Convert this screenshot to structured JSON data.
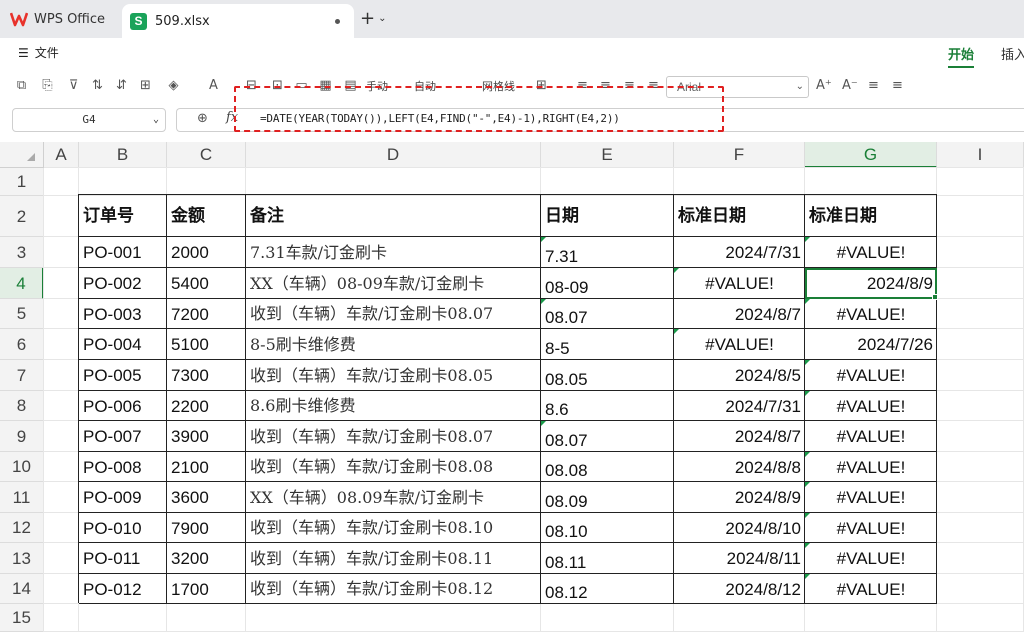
{
  "app": {
    "name": "WPS Office",
    "doc_tab": "509.xlsx",
    "doc_badge": "S"
  },
  "menu": {
    "file": "文件",
    "start": "开始",
    "insert": "插入"
  },
  "toolbar": {
    "manual": "手动",
    "auto": "自动",
    "gridlines": "网格线",
    "font": "Arial"
  },
  "formula_bar": {
    "name_box": "G4",
    "formula": "=DATE(YEAR(TODAY()),LEFT(E4,FIND(\"-\",E4)-1),RIGHT(E4,2))"
  },
  "columns": [
    "A",
    "B",
    "C",
    "D",
    "E",
    "F",
    "G",
    "I"
  ],
  "rows": [
    "1",
    "2",
    "3",
    "4",
    "5",
    "6",
    "7",
    "8",
    "9",
    "10",
    "11",
    "12",
    "13",
    "14",
    "15"
  ],
  "table": {
    "headers": [
      "订单号",
      "金额",
      "备注",
      "日期",
      "标准日期",
      "标准日期"
    ],
    "rows": [
      [
        "PO-001",
        "2000",
        "7.31车款/订金刷卡",
        "7.31",
        "2024/7/31",
        "#VALUE!"
      ],
      [
        "PO-002",
        "5400",
        "XX（车辆）08-09车款/订金刷卡",
        "08-09",
        "#VALUE!",
        "2024/8/9"
      ],
      [
        "PO-003",
        "7200",
        "收到（车辆）车款/订金刷卡08.07",
        "08.07",
        "2024/8/7",
        "#VALUE!"
      ],
      [
        "PO-004",
        "5100",
        "8-5刷卡维修费",
        "8-5",
        "#VALUE!",
        "2024/7/26"
      ],
      [
        "PO-005",
        "7300",
        "收到（车辆）车款/订金刷卡08.05",
        "08.05",
        "2024/8/5",
        "#VALUE!"
      ],
      [
        "PO-006",
        "2200",
        "8.6刷卡维修费",
        "8.6",
        "2024/7/31",
        "#VALUE!"
      ],
      [
        "PO-007",
        "3900",
        "收到（车辆）车款/订金刷卡08.07",
        "08.07",
        "2024/8/7",
        "#VALUE!"
      ],
      [
        "PO-008",
        "2100",
        "收到（车辆）车款/订金刷卡08.08",
        "08.08",
        "2024/8/8",
        "#VALUE!"
      ],
      [
        "PO-009",
        "3600",
        "XX（车辆）08.09车款/订金刷卡",
        "08.09",
        "2024/8/9",
        "#VALUE!"
      ],
      [
        "PO-010",
        "7900",
        "收到（车辆）车款/订金刷卡08.10",
        "08.10",
        "2024/8/10",
        "#VALUE!"
      ],
      [
        "PO-011",
        "3200",
        "收到（车辆）车款/订金刷卡08.11",
        "08.11",
        "2024/8/11",
        "#VALUE!"
      ],
      [
        "PO-012",
        "1700",
        "收到（车辆）车款/订金刷卡08.12",
        "08.12",
        "2024/8/12",
        "#VALUE!"
      ]
    ]
  },
  "colors": {
    "accent": "#1a7f37",
    "highlight": "#e02020"
  }
}
